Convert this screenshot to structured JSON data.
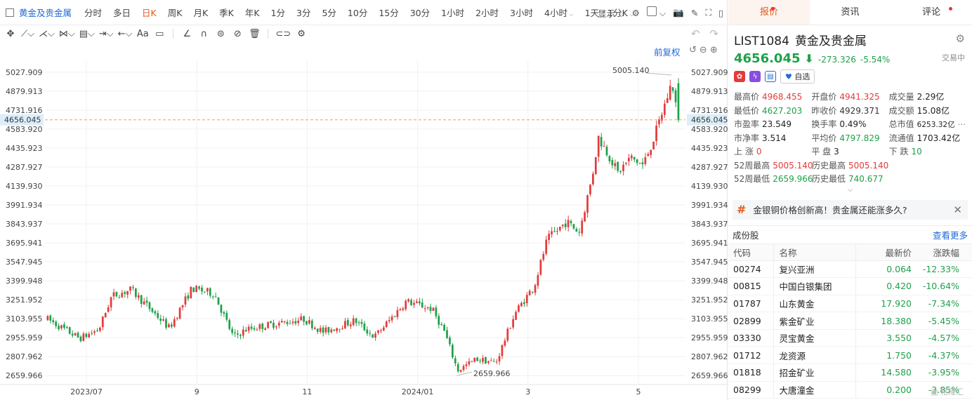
{
  "toolbar": {
    "title": "黄金及贵金属",
    "periods": [
      {
        "label": "分时",
        "active": false
      },
      {
        "label": "多日",
        "active": false
      },
      {
        "label": "日K",
        "active": true
      },
      {
        "label": "周K",
        "active": false
      },
      {
        "label": "月K",
        "active": false
      },
      {
        "label": "季K",
        "active": false
      },
      {
        "label": "年K",
        "active": false
      },
      {
        "label": "1分",
        "active": false
      },
      {
        "label": "3分",
        "active": false
      },
      {
        "label": "5分",
        "active": false
      },
      {
        "label": "10分",
        "active": false
      },
      {
        "label": "15分",
        "active": false
      },
      {
        "label": "30分",
        "active": false
      },
      {
        "label": "1小时",
        "active": false
      },
      {
        "label": "2小时",
        "active": false
      },
      {
        "label": "3小时",
        "active": false
      },
      {
        "label": "4小时",
        "active": false,
        "dropdown": true
      },
      {
        "label": "1天 : 1分K",
        "active": false,
        "dropdown": true
      }
    ],
    "display_label": "显示"
  },
  "draw_toolbar": {
    "text_tool": "Aa"
  },
  "chart": {
    "restore_label": "前复权",
    "last_price_label": "4656.045",
    "high_marker": "5005.140",
    "low_marker": "2659.966"
  },
  "chart_data": {
    "type": "candlestick",
    "y_ticks": [
      "5027.909",
      "4879.913",
      "4731.916",
      "4583.920",
      "4435.923",
      "4287.927",
      "4139.930",
      "3991.934",
      "3843.937",
      "3695.941",
      "3547.945",
      "3399.948",
      "3251.952",
      "3103.955",
      "2955.959",
      "2807.962",
      "2659.966"
    ],
    "x_ticks": [
      "2023/07",
      "9",
      "11",
      "2024/01",
      "3",
      "5"
    ],
    "ylim": [
      2590,
      5120
    ],
    "last_price": 4656.045,
    "period_high": 5005.14,
    "period_low": 2659.966,
    "up_color": "#e33b3b",
    "down_color": "#1fa04a"
  },
  "right_panel": {
    "tabs": [
      {
        "label": "报价",
        "active": true,
        "dot": true
      },
      {
        "label": "资讯",
        "active": false,
        "dot": false
      },
      {
        "label": "评论",
        "active": false,
        "dot": true
      }
    ],
    "code": "LIST1084",
    "name": "黄金及贵金属",
    "price": "4656.045",
    "change": "-273.326",
    "change_pct": "-5.54%",
    "status": "交易中",
    "watch_label": "自选",
    "stats": [
      [
        {
          "label": "最高价",
          "value": "4968.455",
          "color": "red"
        },
        {
          "label": "开盘价",
          "value": "4941.325",
          "color": "red"
        },
        {
          "label": "成交量",
          "value": "2.29亿",
          "color": "blk"
        }
      ],
      [
        {
          "label": "最低价",
          "value": "4627.203",
          "color": "green"
        },
        {
          "label": "昨收价",
          "value": "4929.371",
          "color": "plain"
        },
        {
          "label": "成交额",
          "value": "15.08亿",
          "color": "blk"
        }
      ],
      [
        {
          "label": "市盈率",
          "value": "23.549",
          "color": "blk"
        },
        {
          "label": "换手率",
          "value": "0.49%",
          "color": "blk"
        },
        {
          "label": "总市值",
          "value": "6253.32亿",
          "color": "blk"
        }
      ],
      [
        {
          "label": "市净率",
          "value": "3.514",
          "color": "blk"
        },
        {
          "label": "平均价",
          "value": "4797.829",
          "color": "green"
        },
        {
          "label": "流通值",
          "value": "1703.42亿",
          "color": "blk"
        }
      ],
      [
        {
          "label": "上 涨",
          "value": "0",
          "color": "red"
        },
        {
          "label": "平 盘",
          "value": "3",
          "color": "blk"
        },
        {
          "label": "下 跌",
          "value": "10",
          "color": "green"
        }
      ],
      [
        {
          "label": "52周最高",
          "value": "5005.140",
          "color": "red"
        },
        {
          "label": "历史最高",
          "value": "5005.140",
          "color": "red"
        }
      ],
      [
        {
          "label": "52周最低",
          "value": "2659.966",
          "color": "green"
        },
        {
          "label": "历史最低",
          "value": "740.677",
          "color": "green"
        }
      ]
    ],
    "news": "金银铜价格创新高！贵金属还能涨多久?",
    "constituents_title": "成份股",
    "more_label": "查看更多",
    "table_headers": [
      "代码",
      "名称",
      "最新价",
      "涨跌幅"
    ],
    "constituents": [
      {
        "code": "00274",
        "name": "复兴亚洲",
        "price": "0.064",
        "pct": "-12.33%"
      },
      {
        "code": "00815",
        "name": "中国白银集团",
        "price": "0.420",
        "pct": "-10.64%"
      },
      {
        "code": "01787",
        "name": "山东黄金",
        "price": "17.920",
        "pct": "-7.34%"
      },
      {
        "code": "02899",
        "name": "紫金矿业",
        "price": "18.380",
        "pct": "-5.45%"
      },
      {
        "code": "03330",
        "name": "灵宝黄金",
        "price": "3.550",
        "pct": "-4.57%"
      },
      {
        "code": "01712",
        "name": "龙资源",
        "price": "1.750",
        "pct": "-4.37%"
      },
      {
        "code": "01818",
        "name": "招金矿业",
        "price": "14.580",
        "pct": "-3.95%"
      },
      {
        "code": "08299",
        "name": "大唐潼金",
        "price": "0.200",
        "pct": "-3.85%"
      }
    ],
    "watermark": "格隆汇"
  }
}
